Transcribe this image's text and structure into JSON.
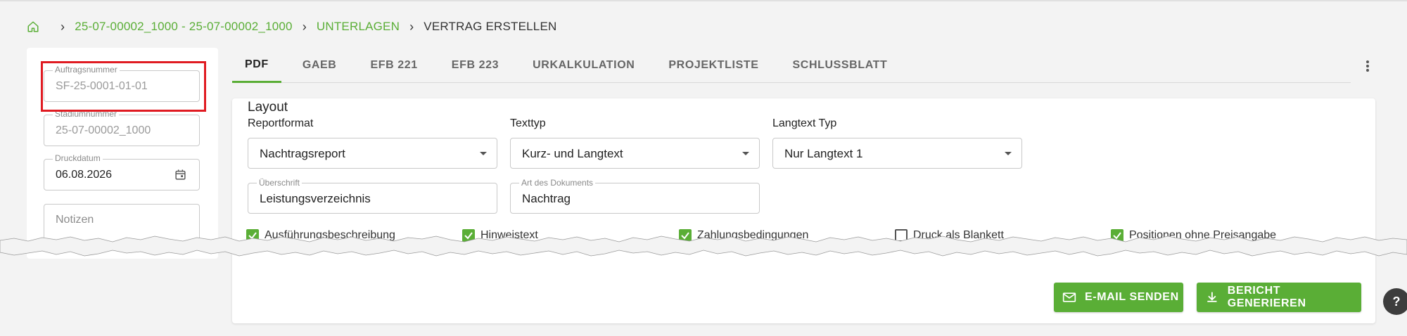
{
  "breadcrumb": {
    "items": [
      {
        "label": "25-07-00002_1000 - 25-07-00002_1000"
      },
      {
        "label": "UNTERLAGEN"
      },
      {
        "label": "VERTRAG ERSTELLEN"
      }
    ]
  },
  "left": {
    "auftragsnummer": {
      "label": "Auftragsnummer",
      "value": "SF-25-0001-01-01"
    },
    "stadiumnummer": {
      "label": "Stadiumnummer",
      "value": "25-07-00002_1000"
    },
    "druckdatum": {
      "label": "Druckdatum",
      "value": "06.08.2026"
    },
    "notizen": {
      "placeholder": "Notizen"
    }
  },
  "tabs": [
    {
      "label": "PDF"
    },
    {
      "label": "GAEB"
    },
    {
      "label": "EFB 221"
    },
    {
      "label": "EFB 223"
    },
    {
      "label": "URKALKULATION"
    },
    {
      "label": "PROJEKTLISTE"
    },
    {
      "label": "SCHLUSSBLATT"
    }
  ],
  "layout": {
    "title": "Layout",
    "reportformat": {
      "label": "Reportformat",
      "value": "Nachtragsreport"
    },
    "texttyp": {
      "label": "Texttyp",
      "value": "Kurz- und Langtext"
    },
    "langtexttyp": {
      "label": "Langtext Typ",
      "value": "Nur Langtext 1"
    },
    "ueberschrift": {
      "label": "Überschrift",
      "value": "Leistungsverzeichnis"
    },
    "artdokument": {
      "label": "Art des Dokuments",
      "value": "Nachtrag"
    },
    "checkboxes": [
      {
        "label": "Ausführungsbeschreibung",
        "checked": true
      },
      {
        "label": "Hinweistext",
        "checked": true
      },
      {
        "label": "Zahlungsbedingungen",
        "checked": true
      },
      {
        "label": "Druck als Blankett",
        "checked": false
      },
      {
        "label": "Positionen ohne Preisangabe",
        "checked": true
      }
    ]
  },
  "actions": {
    "email": "E-MAIL SENDEN",
    "report": "BERICHT GENERIEREN"
  },
  "colors": {
    "accent": "#5aae36",
    "highlight": "#e01b22"
  }
}
